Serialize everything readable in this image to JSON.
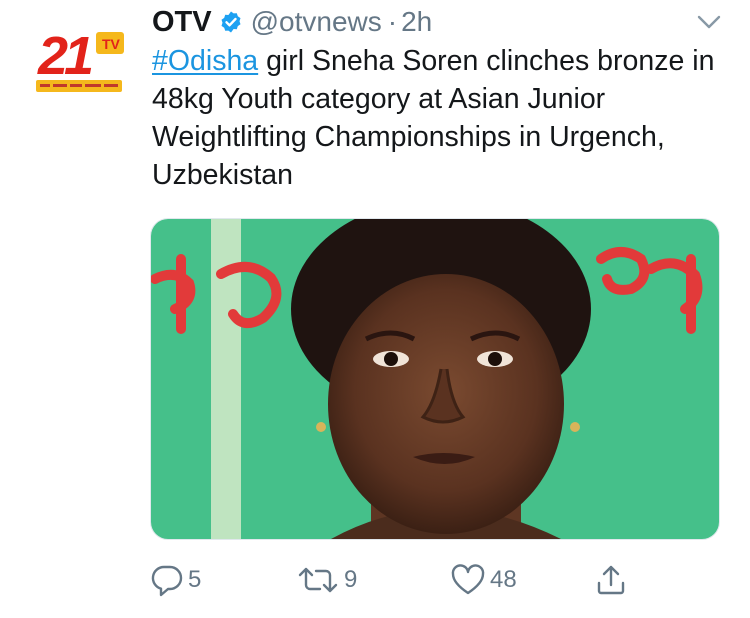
{
  "tweet": {
    "display_name": "OTV",
    "handle": "@otvnews",
    "separator": "·",
    "time": "2h",
    "hashtag": "#Odisha",
    "text_body": " girl Sneha Soren clinches bronze in 48kg Youth category at Asian Junior Weightlifting Championships in Urgench, Uzbekistan",
    "avatar": {
      "logo_text": "21",
      "badge_text": "TV",
      "tagline": "ଓଡ଼ିଶାର ଖବର ଓଡ଼ିଆରେ",
      "brand_color": "#e2231a",
      "accent_color": "#f5b81c"
    },
    "media": {
      "description_icon": "photo"
    },
    "actions": {
      "reply_count": "5",
      "retweet_count": "9",
      "like_count": "48"
    },
    "colors": {
      "text": "#14171a",
      "secondary": "#657786",
      "link": "#1b95e0",
      "verified": "#1da1f2"
    }
  }
}
